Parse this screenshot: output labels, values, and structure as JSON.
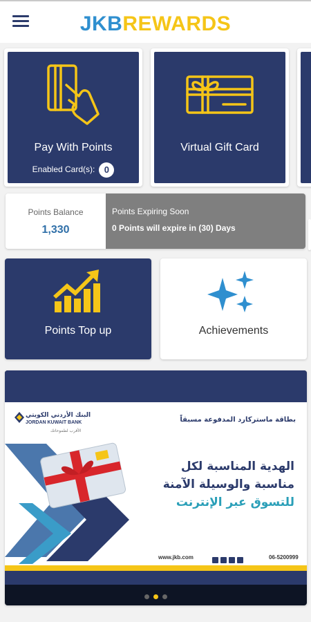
{
  "header": {
    "logo_part1": "JKB",
    "logo_part2": "REWARDS",
    "menu_icon": "hamburger-menu-icon"
  },
  "cards": [
    {
      "label": "Pay With Points",
      "icon": "card-in-hand-icon",
      "enabled_label": "Enabled Card(s):",
      "enabled_count": "0"
    },
    {
      "label": "Virtual Gift Card",
      "icon": "gift-card-icon"
    }
  ],
  "points": {
    "balance_label": "Points Balance",
    "balance_value": "1,330",
    "expiring_title": "Points Expiring Soon",
    "expiring_text": "0 Points will expire in (30) Days"
  },
  "tiles": [
    {
      "label": "Points Top up",
      "icon": "chart-up-icon"
    },
    {
      "label": "Achievements",
      "icon": "sparkles-icon"
    }
  ],
  "banner": {
    "bank_name_ar": "البنك الأردني الكويتي",
    "bank_name_en": "JORDAN KUWAIT BANK",
    "bank_tagline": "الأقرب لطموحاتك",
    "promo_sub": "بطاقة ماستركارد المدفوعة مسبقاً",
    "promo_line1": "الهدية المناسبة لكل",
    "promo_line2": "مناسبة والوسيلة الآمنة",
    "promo_line3": "للتسوق عبر الإنترنت",
    "website": "www.jkb.com",
    "phone": "06-5200999"
  },
  "colors": {
    "navy": "#2b3a6b",
    "yellow": "#f5c518",
    "blue": "#2f8fcf",
    "gray": "#7f7f7f"
  },
  "carousel": {
    "active_index": 1,
    "count": 3
  }
}
